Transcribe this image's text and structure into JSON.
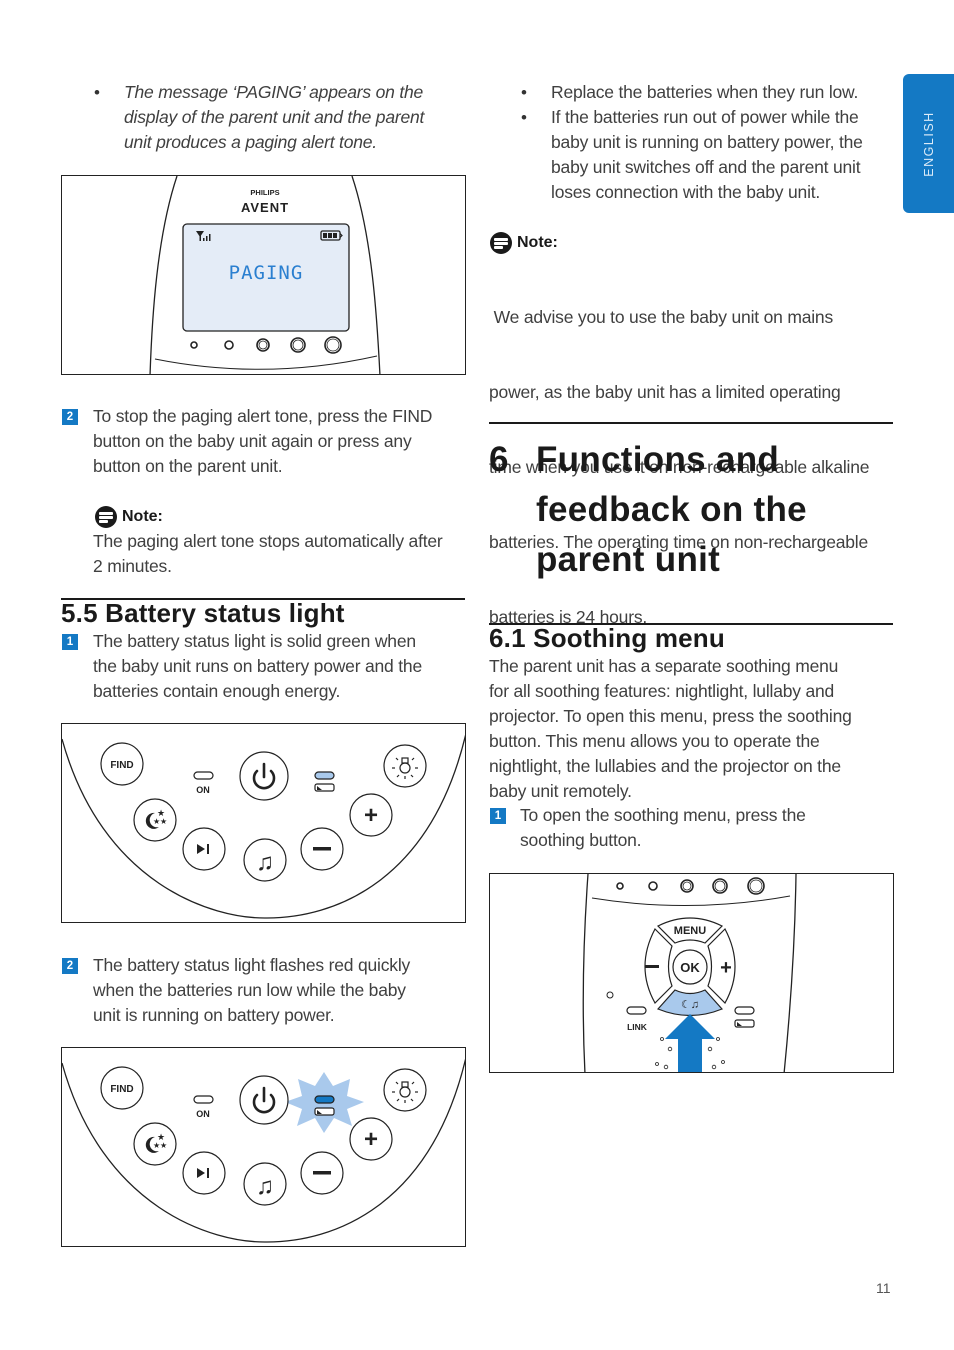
{
  "side_tab": {
    "label": "ENGLISH"
  },
  "page_number": "11",
  "left": {
    "paging_bullet": {
      "lines": [
        "The message ‘PAGING’ appears on the",
        "display of the parent unit and the parent",
        "unit produces a paging alert tone."
      ]
    },
    "figure_paging": {
      "brand_top": "PHILIPS",
      "brand_bottom": "AVENT",
      "display_text": "PAGING",
      "icons": [
        "signal-strength-icon",
        "battery-full-icon"
      ]
    },
    "step2_paging": {
      "number": "2",
      "lines": [
        "To stop the paging alert tone, press the FIND",
        "button on the baby unit again or press any",
        "button on the parent unit."
      ]
    },
    "note_paging": {
      "title": "Note:",
      "lines": [
        "The paging alert tone stops automatically after",
        "2 minutes."
      ]
    },
    "section_5_5": {
      "heading": "5.5  Battery status light",
      "step1": {
        "number": "1",
        "lines": [
          "The battery status light is solid green when",
          "the baby unit runs on battery power and the",
          "batteries contain enough energy."
        ]
      },
      "step2": {
        "number": "2",
        "lines": [
          "The battery status light flashes red quickly",
          "when the batteries run low while the baby",
          "unit is running on battery power."
        ]
      }
    },
    "figure_baby_unit": {
      "find_label": "FIND",
      "on_label": "ON"
    }
  },
  "right": {
    "bullets": [
      {
        "lines": [
          "Replace the batteries when they run low."
        ]
      },
      {
        "lines": [
          "If the batteries run out of power while the",
          "baby unit is running on battery power, the",
          "baby unit switches off and the parent unit",
          "loses connection with the baby unit."
        ]
      }
    ],
    "note_batteries": {
      "title": "Note:",
      "lines": [
        " We advise you to use the baby unit on mains",
        "power, as the baby unit has a limited operating",
        "time when you use it on non-rechargeable alkaline",
        "batteries. The operating time on non-rechargeable",
        "batteries is 24 hours."
      ]
    },
    "chapter_6": {
      "number": "6",
      "title_lines": [
        "Functions and",
        "feedback on the",
        "parent unit"
      ]
    },
    "section_6_1": {
      "heading": "6.1  Soothing menu",
      "intro_lines": [
        "The parent unit has a separate soothing menu",
        "for all soothing features: nightlight, lullaby and",
        "projector. To open this menu, press the soothing",
        "button. This menu allows you to operate the",
        "nightlight, the lullabies and the projector on the",
        "baby unit remotely."
      ],
      "step1": {
        "number": "1",
        "lines": [
          "To open the soothing menu, press the",
          "soothing button."
        ]
      }
    },
    "figure_soothing": {
      "menu_label": "MENU",
      "ok_label": "OK",
      "link_label": "LINK"
    }
  },
  "colors": {
    "accent_blue": "#1479c4",
    "light_blue": "#a9c9ec",
    "lcd_bg": "#e4ecf7",
    "lcd_text": "#2a7fd0"
  }
}
